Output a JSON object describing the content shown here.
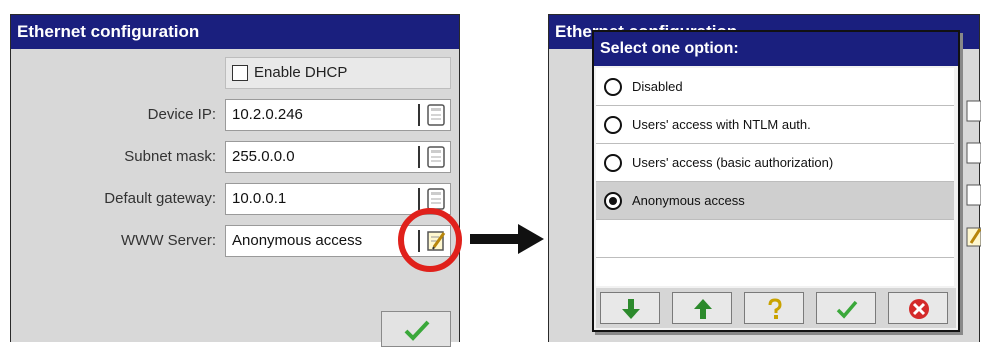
{
  "left": {
    "title": "Ethernet configuration",
    "dhcp": {
      "label": "Enable DHCP",
      "checked": false
    },
    "fields": [
      {
        "label": "Device IP:",
        "value": "10.2.0.246",
        "icon": "keyboard-icon"
      },
      {
        "label": "Subnet mask:",
        "value": "255.0.0.0",
        "icon": "keyboard-icon"
      },
      {
        "label": "Default gateway:",
        "value": "10.0.0.1",
        "icon": "keyboard-icon"
      },
      {
        "label": "WWW Server:",
        "value": "Anonymous access",
        "icon": "edit-icon"
      }
    ],
    "ok_icon": "checkmark-icon",
    "highlight_color": "#e0211b"
  },
  "arrow": {
    "icon": "right-arrow-icon"
  },
  "right": {
    "background_title": "Ethernet configuration",
    "modal": {
      "title": "Select one option:",
      "options": [
        {
          "label": "Disabled",
          "selected": false
        },
        {
          "label": "Users' access with NTLM auth.",
          "selected": false
        },
        {
          "label": "Users' access (basic authorization)",
          "selected": false
        },
        {
          "label": "Anonymous access",
          "selected": true
        }
      ],
      "buttons": [
        "down-arrow-icon",
        "up-arrow-icon",
        "help-icon",
        "checkmark-icon",
        "cancel-icon"
      ]
    }
  },
  "colors": {
    "titlebar": "#1a1f7e",
    "panel": "#d8d8d8",
    "selected_row": "#cfcfcf"
  }
}
